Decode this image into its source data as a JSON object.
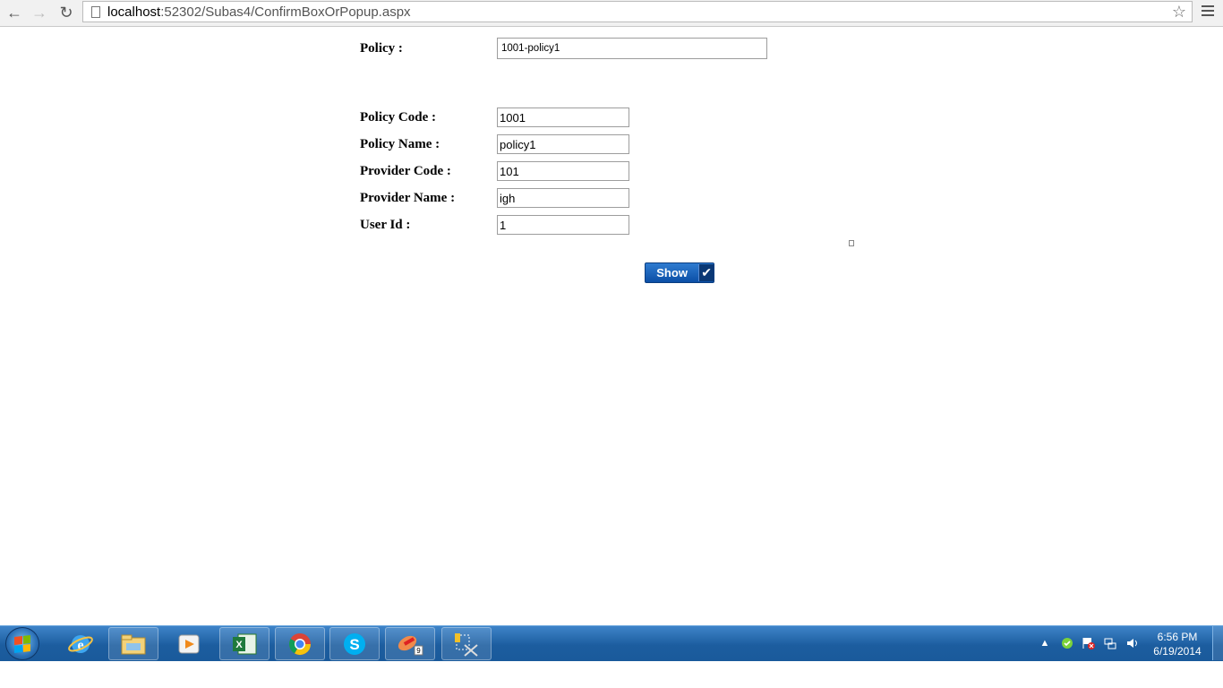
{
  "browser": {
    "url_host": "localhost",
    "url_path": ":52302/Subas4/ConfirmBoxOrPopup.aspx"
  },
  "form": {
    "policy_label": "Policy :",
    "policy_value": "1001-policy1",
    "fields": [
      {
        "label": "Policy Code :",
        "value": "1001"
      },
      {
        "label": "Policy Name :",
        "value": "policy1"
      },
      {
        "label": "Provider Code :",
        "value": "101"
      },
      {
        "label": "Provider Name :",
        "value": "igh"
      },
      {
        "label": "User Id :",
        "value": "1"
      }
    ],
    "show_button": "Show"
  },
  "taskbar": {
    "pinned": [
      "internet-explorer-icon",
      "file-explorer-icon",
      "media-player-icon",
      "excel-icon",
      "chrome-icon",
      "skype-icon",
      "paint-tool-icon",
      "snipping-tool-icon"
    ],
    "badge_count": "9",
    "time": "6:56 PM",
    "date": "6/19/2014"
  },
  "colors": {
    "button_blue": "#0b4fa6",
    "taskbar_blue": "#1c5d9f"
  }
}
